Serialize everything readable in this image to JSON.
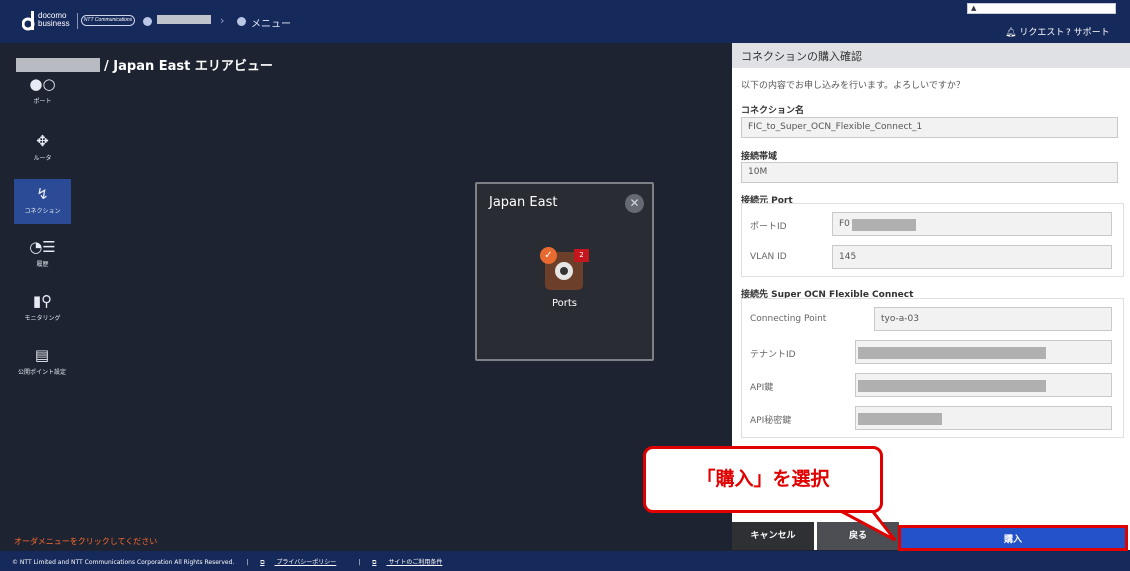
{
  "header": {
    "brand_line1": "docomo",
    "brand_line2": "business",
    "ntt_badge": "NTT Communications",
    "breadcrumb_menu": "メニュー",
    "request": "リクエスト",
    "support": "サポート"
  },
  "view": {
    "title_suffix": "/ Japan East エリアビュー"
  },
  "sidebar": [
    {
      "label": "ポート",
      "icon": "port-icon"
    },
    {
      "label": "ルータ",
      "icon": "router-icon"
    },
    {
      "label": "コネクション",
      "icon": "connection-icon",
      "active": true
    },
    {
      "label": "履歴",
      "icon": "history-icon"
    },
    {
      "label": "モニタリング",
      "icon": "monitoring-icon"
    },
    {
      "label": "公開ポイント設定",
      "icon": "public-point-icon"
    }
  ],
  "order_hint": "オーダメニューをクリックしてください",
  "area": {
    "title": "Japan East",
    "port_label": "Ports",
    "port_count": "2"
  },
  "panel": {
    "title": "コネクションの購入確認",
    "message": "以下の内容でお申し込みを行います。よろしいですか？",
    "connection_name_label": "コネクション名",
    "connection_name": "FIC_to_Super_OCN_Flexible_Connect_1",
    "bandwidth_label": "接続帯域",
    "bandwidth": "10M",
    "source_label": "接続元 Port",
    "port_id_label": "ポートID",
    "port_id_prefix": "F0",
    "vlan_label": "VLAN ID",
    "vlan": "145",
    "dest_label": "接続先 Super OCN Flexible Connect",
    "cp_label": "Connecting Point",
    "cp": "tyo-a-03",
    "tenant_label": "テナントID",
    "apikey_label": "API鍵",
    "apisecret_label": "API秘密鍵"
  },
  "buttons": {
    "cancel": "キャンセル",
    "back": "戻る",
    "buy": "購入"
  },
  "callout": "「購入」を選択",
  "footer": {
    "copyright": "© NTT Limited and NTT Communications Corporation All Rights Reserved.",
    "privacy": "プライバシーポリシー",
    "terms": "サイトのご利用条件"
  },
  "colors": {
    "header": "#16295b",
    "accent": "#2452c9",
    "highlight": "#e00000",
    "orange": "#ff6b2a"
  }
}
